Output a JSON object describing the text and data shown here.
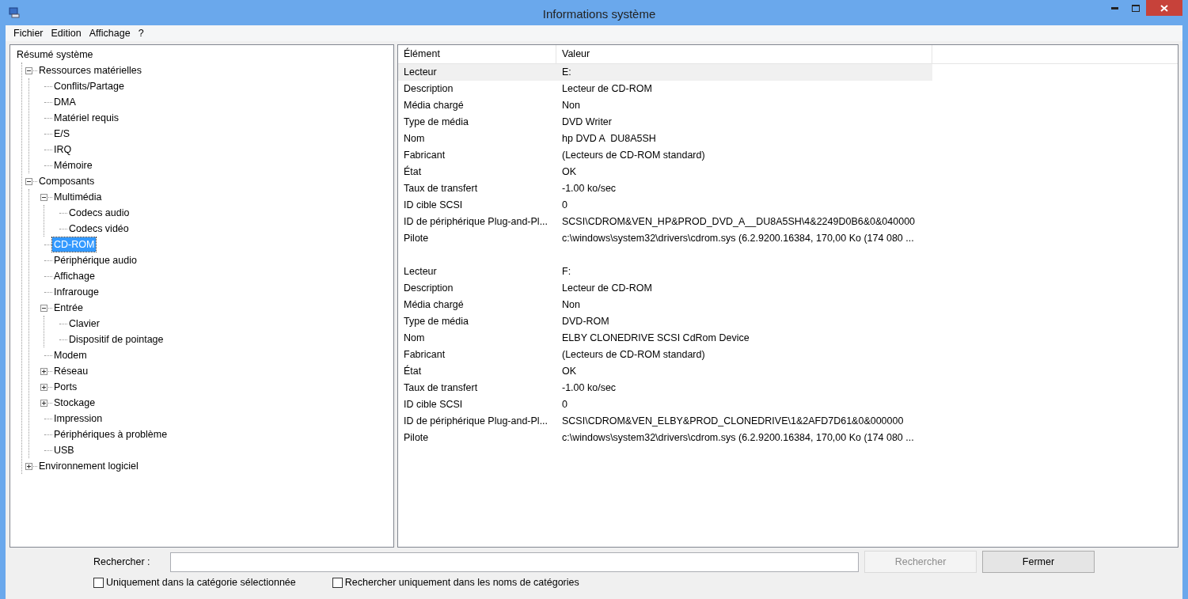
{
  "window": {
    "title": "Informations système"
  },
  "menu": [
    "Fichier",
    "Edition",
    "Affichage",
    "?"
  ],
  "tree": [
    {
      "label": "Résumé système",
      "selected": false,
      "children": [
        {
          "label": "Ressources matérielles",
          "selected": false,
          "expanded": true,
          "children": [
            {
              "label": "Conflits/Partage",
              "selected": false
            },
            {
              "label": "DMA",
              "selected": false
            },
            {
              "label": "Matériel requis",
              "selected": false
            },
            {
              "label": "E/S",
              "selected": false
            },
            {
              "label": "IRQ",
              "selected": false
            },
            {
              "label": "Mémoire",
              "selected": false
            }
          ]
        },
        {
          "label": "Composants",
          "selected": false,
          "expanded": true,
          "children": [
            {
              "label": "Multimédia",
              "selected": false,
              "expanded": true,
              "children": [
                {
                  "label": "Codecs audio",
                  "selected": false
                },
                {
                  "label": "Codecs vidéo",
                  "selected": false
                }
              ]
            },
            {
              "label": "CD-ROM",
              "selected": true
            },
            {
              "label": "Périphérique audio",
              "selected": false
            },
            {
              "label": "Affichage",
              "selected": false
            },
            {
              "label": "Infrarouge",
              "selected": false
            },
            {
              "label": "Entrée",
              "selected": false,
              "expanded": true,
              "children": [
                {
                  "label": "Clavier",
                  "selected": false
                },
                {
                  "label": "Dispositif de pointage",
                  "selected": false
                }
              ]
            },
            {
              "label": "Modem",
              "selected": false
            },
            {
              "label": "Réseau",
              "selected": false,
              "expanded": false
            },
            {
              "label": "Ports",
              "selected": false,
              "expanded": false
            },
            {
              "label": "Stockage",
              "selected": false,
              "expanded": false
            },
            {
              "label": "Impression",
              "selected": false
            },
            {
              "label": "Périphériques à problème",
              "selected": false
            },
            {
              "label": "USB",
              "selected": false
            }
          ]
        },
        {
          "label": "Environnement logiciel",
          "selected": false,
          "expanded": false
        }
      ]
    }
  ],
  "table": {
    "columns": [
      "Élément",
      "Valeur"
    ],
    "groups": [
      {
        "rows": [
          {
            "item": "Lecteur",
            "value": "E:",
            "selected": true
          },
          {
            "item": "Description",
            "value": "Lecteur de CD-ROM",
            "selected": false
          },
          {
            "item": "Média chargé",
            "value": "Non",
            "selected": false
          },
          {
            "item": "Type de média",
            "value": "DVD Writer",
            "selected": false
          },
          {
            "item": "Nom",
            "value": "hp DVD A  DU8A5SH",
            "selected": false
          },
          {
            "item": "Fabricant",
            "value": "(Lecteurs de CD-ROM standard)",
            "selected": false
          },
          {
            "item": "État",
            "value": "OK",
            "selected": false
          },
          {
            "item": "Taux de transfert",
            "value": "-1.00 ko/sec",
            "selected": false
          },
          {
            "item": "ID cible SCSI",
            "value": "0",
            "selected": false
          },
          {
            "item": "ID de périphérique Plug-and-Pl...",
            "value": "SCSI\\CDROM&VEN_HP&PROD_DVD_A__DU8A5SH\\4&2249D0B6&0&040000",
            "selected": false
          },
          {
            "item": "Pilote",
            "value": "c:\\windows\\system32\\drivers\\cdrom.sys (6.2.9200.16384, 170,00 Ko (174 080 ...",
            "selected": false
          }
        ]
      },
      {
        "rows": [
          {
            "item": "Lecteur",
            "value": "F:",
            "selected": false
          },
          {
            "item": "Description",
            "value": "Lecteur de CD-ROM",
            "selected": false
          },
          {
            "item": "Média chargé",
            "value": "Non",
            "selected": false
          },
          {
            "item": "Type de média",
            "value": "DVD-ROM",
            "selected": false
          },
          {
            "item": "Nom",
            "value": "ELBY CLONEDRIVE SCSI CdRom Device",
            "selected": false
          },
          {
            "item": "Fabricant",
            "value": "(Lecteurs de CD-ROM standard)",
            "selected": false
          },
          {
            "item": "État",
            "value": "OK",
            "selected": false
          },
          {
            "item": "Taux de transfert",
            "value": "-1.00 ko/sec",
            "selected": false
          },
          {
            "item": "ID cible SCSI",
            "value": "0",
            "selected": false
          },
          {
            "item": "ID de périphérique Plug-and-Pl...",
            "value": "SCSI\\CDROM&VEN_ELBY&PROD_CLONEDRIVE\\1&2AFD7D61&0&000000",
            "selected": false
          },
          {
            "item": "Pilote",
            "value": "c:\\windows\\system32\\drivers\\cdrom.sys (6.2.9200.16384, 170,00 Ko (174 080 ...",
            "selected": false
          }
        ]
      }
    ]
  },
  "search": {
    "label": "Rechercher :",
    "search_button": {
      "label": "Rechercher",
      "disabled": true
    },
    "close_button": {
      "label": "Fermer",
      "disabled": false
    }
  },
  "options": [
    {
      "label": "Uniquement dans la catégorie sélectionnée",
      "checked": false
    },
    {
      "label": "Rechercher uniquement dans les noms de catégories",
      "checked": false
    }
  ]
}
